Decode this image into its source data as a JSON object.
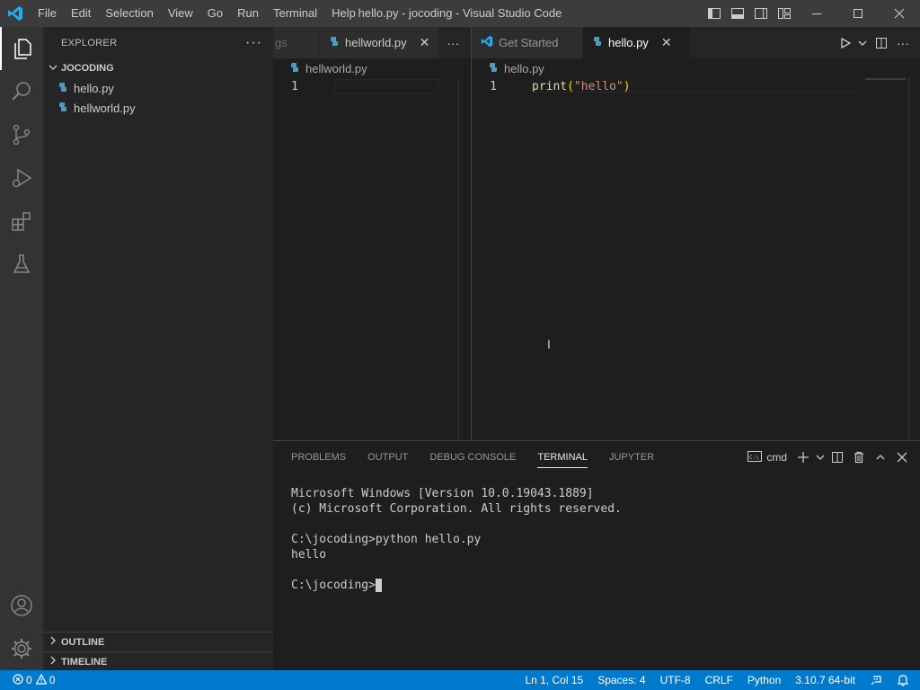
{
  "menu": [
    "File",
    "Edit",
    "Selection",
    "View",
    "Go",
    "Run",
    "Terminal",
    "Help"
  ],
  "window_title": "hello.py - jocoding - Visual Studio Code",
  "sidebar": {
    "title": "EXPLORER",
    "folder": "JOCODING",
    "files": [
      "hello.py",
      "hellworld.py"
    ],
    "outline": "OUTLINE",
    "timeline": "TIMELINE"
  },
  "group1": {
    "partial_tab": "gs",
    "tab_label": "hellworld.py",
    "breadcrumb": "hellworld.py",
    "line_number": "1"
  },
  "group2": {
    "tab_get_started": "Get Started",
    "tab_active": "hello.py",
    "breadcrumb": "hello.py",
    "line_number": "1",
    "code_fn": "print",
    "code_open": "(",
    "code_str": "\"hello\"",
    "code_close": ")"
  },
  "panel": {
    "tabs": [
      "PROBLEMS",
      "OUTPUT",
      "DEBUG CONSOLE",
      "TERMINAL",
      "JUPYTER"
    ],
    "active_tab": "TERMINAL",
    "shell": "cmd",
    "terminal_lines": [
      "Microsoft Windows [Version 10.0.19043.1889]",
      "(c) Microsoft Corporation. All rights reserved.",
      "",
      "C:\\jocoding>python hello.py",
      "hello",
      ""
    ],
    "prompt": "C:\\jocoding>"
  },
  "status": {
    "errors": "0",
    "warnings": "0",
    "position": "Ln 1, Col 15",
    "spaces": "Spaces: 4",
    "encoding": "UTF-8",
    "eol": "CRLF",
    "language": "Python",
    "interpreter": "3.10.7 64-bit"
  },
  "colors": {
    "accent": "#007acc",
    "python_icon": "#519aba",
    "string": "#ce9178",
    "function": "#dcdcaa"
  }
}
